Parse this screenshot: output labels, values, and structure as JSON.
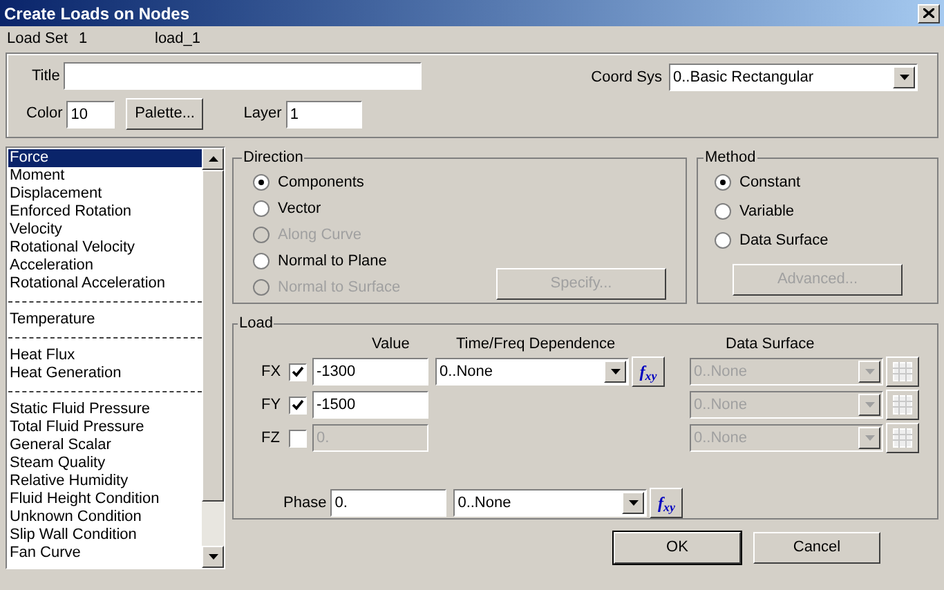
{
  "window": {
    "title": "Create Loads on Nodes"
  },
  "load_set": {
    "label": "Load Set",
    "number": "1",
    "name": "load_1"
  },
  "properties": {
    "title_label": "Title",
    "coord_sys_label": "Coord Sys",
    "coord_sys_value": "0..Basic Rectangular",
    "color_label": "Color",
    "color_value": "10",
    "palette_button": "Palette...",
    "layer_label": "Layer",
    "layer_value": "1"
  },
  "load_types": [
    {
      "kind": "item",
      "label": "Force",
      "selected": true
    },
    {
      "kind": "item",
      "label": "Moment",
      "selected": false
    },
    {
      "kind": "item",
      "label": "Displacement",
      "selected": false
    },
    {
      "kind": "item",
      "label": "Enforced Rotation",
      "selected": false
    },
    {
      "kind": "item",
      "label": "Velocity",
      "selected": false
    },
    {
      "kind": "item",
      "label": "Rotational Velocity",
      "selected": false
    },
    {
      "kind": "item",
      "label": "Acceleration",
      "selected": false
    },
    {
      "kind": "item",
      "label": "Rotational Acceleration",
      "selected": false
    },
    {
      "kind": "separator"
    },
    {
      "kind": "item",
      "label": "Temperature",
      "selected": false
    },
    {
      "kind": "separator"
    },
    {
      "kind": "item",
      "label": "Heat Flux",
      "selected": false
    },
    {
      "kind": "item",
      "label": "Heat Generation",
      "selected": false
    },
    {
      "kind": "separator"
    },
    {
      "kind": "item",
      "label": "Static Fluid Pressure",
      "selected": false
    },
    {
      "kind": "item",
      "label": "Total Fluid Pressure",
      "selected": false
    },
    {
      "kind": "item",
      "label": "General Scalar",
      "selected": false
    },
    {
      "kind": "item",
      "label": "Steam Quality",
      "selected": false
    },
    {
      "kind": "item",
      "label": "Relative Humidity",
      "selected": false
    },
    {
      "kind": "item",
      "label": "Fluid Height Condition",
      "selected": false
    },
    {
      "kind": "item",
      "label": "Unknown Condition",
      "selected": false
    },
    {
      "kind": "item",
      "label": "Slip Wall Condition",
      "selected": false
    },
    {
      "kind": "item",
      "label": "Fan Curve",
      "selected": false
    }
  ],
  "direction": {
    "title": "Direction",
    "options": [
      {
        "label": "Components",
        "selected": true,
        "disabled": false
      },
      {
        "label": "Vector",
        "selected": false,
        "disabled": false
      },
      {
        "label": "Along Curve",
        "selected": false,
        "disabled": true
      },
      {
        "label": "Normal to Plane",
        "selected": false,
        "disabled": false
      },
      {
        "label": "Normal to Surface",
        "selected": false,
        "disabled": true
      }
    ],
    "specify_button": {
      "label": "Specify...",
      "disabled": true
    }
  },
  "method": {
    "title": "Method",
    "options": [
      {
        "label": "Constant",
        "selected": true,
        "disabled": false
      },
      {
        "label": "Variable",
        "selected": false,
        "disabled": false
      },
      {
        "label": "Data Surface",
        "selected": false,
        "disabled": false
      }
    ],
    "advanced_button": {
      "label": "Advanced...",
      "disabled": true
    }
  },
  "load": {
    "title": "Load",
    "columns": [
      "Value",
      "Time/Freq Dependence",
      "Data Surface"
    ],
    "rows": [
      {
        "label": "FX",
        "checked": true,
        "value": "-1300",
        "time_dependence": "0..None",
        "function_button": "f$_{xy}$",
        "data_surface": "0..None"
      },
      {
        "label": "FY",
        "checked": true,
        "value": "-1500",
        "data_surface": "0..None"
      },
      {
        "label": "FZ",
        "checked": false,
        "value": "0.",
        "data_surface": "0..None"
      }
    ],
    "phase": {
      "label": "Phase",
      "value": "0.",
      "time_dependence": "0..None",
      "function_button": "f$_{xy}$"
    }
  },
  "buttons": [
    {
      "label": "OK",
      "default": true
    },
    {
      "label": "Cancel",
      "default": false
    }
  ]
}
